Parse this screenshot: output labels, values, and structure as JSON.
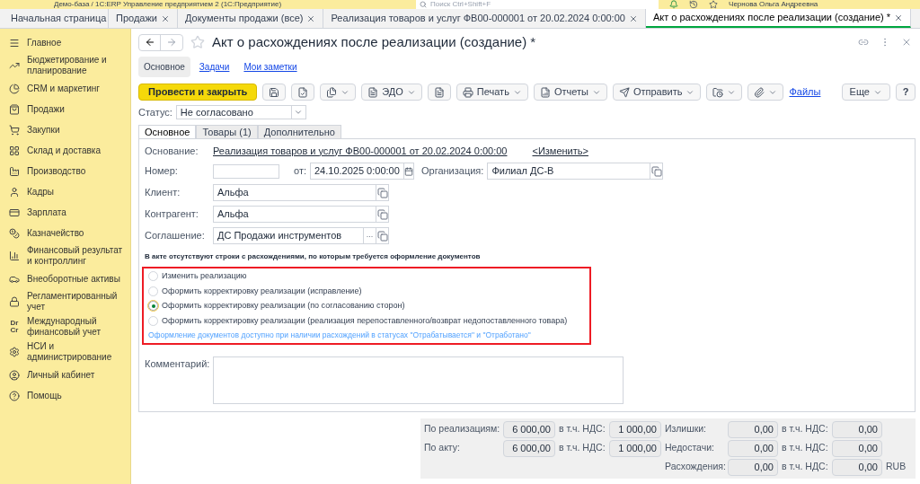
{
  "window": {
    "title": "Демо-база / 1С:ERP Управление предприятием 2  (1С:Предприятие)",
    "search_placeholder": "Поиск Ctrl+Shift+F",
    "user": "Чернова Ольга Андреевна"
  },
  "open_tabs": [
    {
      "label": "Начальная страница",
      "kind": "home",
      "selected": false
    },
    {
      "label": "Продажи",
      "kind": "tab",
      "selected": false
    },
    {
      "label": "Документы продажи (все)",
      "kind": "tab",
      "selected": false
    },
    {
      "label": "Реализация товаров и услуг ФВ00-000001 от 20.02.2024 0:00:00",
      "kind": "tab",
      "selected": false
    },
    {
      "label": "Акт о расхождениях после реализации (создание) *",
      "kind": "tab",
      "selected": true
    }
  ],
  "sidebar": {
    "items": [
      {
        "label": "Главное"
      },
      {
        "label": "Бюджетирование и планирование"
      },
      {
        "label": "CRM и маркетинг"
      },
      {
        "label": "Продажи"
      },
      {
        "label": "Закупки"
      },
      {
        "label": "Склад и доставка"
      },
      {
        "label": "Производство"
      },
      {
        "label": "Кадры"
      },
      {
        "label": "Зарплата"
      },
      {
        "label": "Казначейство"
      },
      {
        "label": "Финансовый результат и контроллинг"
      },
      {
        "label": "Внеоборотные активы"
      },
      {
        "label": "Регламентированный учет"
      },
      {
        "label": "Международный финансовый учет",
        "icon_text": "Dr Cr"
      },
      {
        "label": "НСИ и администрирование"
      },
      {
        "label": "Личный кабинет"
      },
      {
        "label": "Помощь"
      }
    ]
  },
  "form": {
    "title": "Акт о расхождениях после реализации (создание) *",
    "sections": [
      {
        "label": "Основное",
        "selected": true
      },
      {
        "label": "Задачи",
        "selected": false
      },
      {
        "label": "Мои заметки",
        "selected": false
      }
    ],
    "toolbar": [
      {
        "kind": "primary",
        "label": "Провести и закрыть"
      },
      {
        "kind": "save"
      },
      {
        "kind": "post"
      },
      {
        "kind": "create",
        "dropdown": true
      },
      {
        "kind": "edo",
        "label": "ЭДО",
        "dropdown": true
      },
      {
        "kind": "doc"
      },
      {
        "kind": "print",
        "label": "Печать",
        "dropdown": true
      },
      {
        "kind": "reports",
        "label": "Отчеты",
        "dropdown": true
      },
      {
        "kind": "send",
        "label": "Отправить",
        "dropdown": true
      },
      {
        "kind": "folder",
        "dropdown": true
      },
      {
        "kind": "clip",
        "dropdown": true
      },
      {
        "kind": "link",
        "label": "Файлы"
      }
    ],
    "more_button": "Еще",
    "help_button": "?",
    "status": {
      "label": "Статус:",
      "value": "Не согласовано"
    },
    "tabs": [
      {
        "label": "Основное",
        "selected": true
      },
      {
        "label": "Товары (1)",
        "selected": false
      },
      {
        "label": "Дополнительно",
        "selected": false
      }
    ],
    "basis": {
      "label": "Основание:",
      "value": "Реализация товаров и услуг ФВ00-000001 от 20.02.2024 0:00:00",
      "change_link": "<Изменить>"
    },
    "number": {
      "label": "Номер:"
    },
    "date": {
      "label": "от:",
      "value": "24.10.2025  0:00:00"
    },
    "organization": {
      "label": "Организация:",
      "value": "Филиал ДС-В"
    },
    "client": {
      "label": "Клиент:",
      "value": "Альфа"
    },
    "counterparty": {
      "label": "Контрагент:",
      "value": "Альфа"
    },
    "agreement": {
      "label": "Соглашение:",
      "value": "ДС Продажи инструментов",
      "select_button": "..."
    },
    "notice": "В акте отсутствуют строки с расхождениями, по которым требуется оформление документов",
    "options": [
      {
        "label": "Изменить реализацию",
        "selected": false
      },
      {
        "label": "Оформить корректировку реализации (исправление)",
        "selected": false
      },
      {
        "label": "Оформить корректировку реализации (по согласованию сторон)",
        "selected": true
      },
      {
        "label": "Оформить корректировку реализации (реализация перепоставленного/возврат недопоставленного товара)",
        "selected": false
      }
    ],
    "options_hint": "Оформление документов доступно при наличии расхождений в статусах \"Отрабатывается\" и \"Отработано\"",
    "comment": {
      "label": "Комментарий:"
    }
  },
  "totals": {
    "rows": [
      {
        "label": "По реализациям:",
        "value": "6 000,00",
        "vat_label": "в т.ч. НДС:",
        "vat": "1 000,00",
        "label2": "Излишки:",
        "value2": "0,00",
        "vat_label2": "в т.ч. НДС:",
        "vat2": "0,00"
      },
      {
        "label": "По акту:",
        "value": "6 000,00",
        "vat_label": "в т.ч. НДС:",
        "vat": "1 000,00",
        "label2": "Недостачи:",
        "value2": "0,00",
        "vat_label2": "в т.ч. НДС:",
        "vat2": "0,00"
      },
      {
        "label2": "Расхождения:",
        "value2": "0,00",
        "vat_label2": "в т.ч. НДС:",
        "vat2": "0,00",
        "currency": "RUB"
      }
    ]
  }
}
